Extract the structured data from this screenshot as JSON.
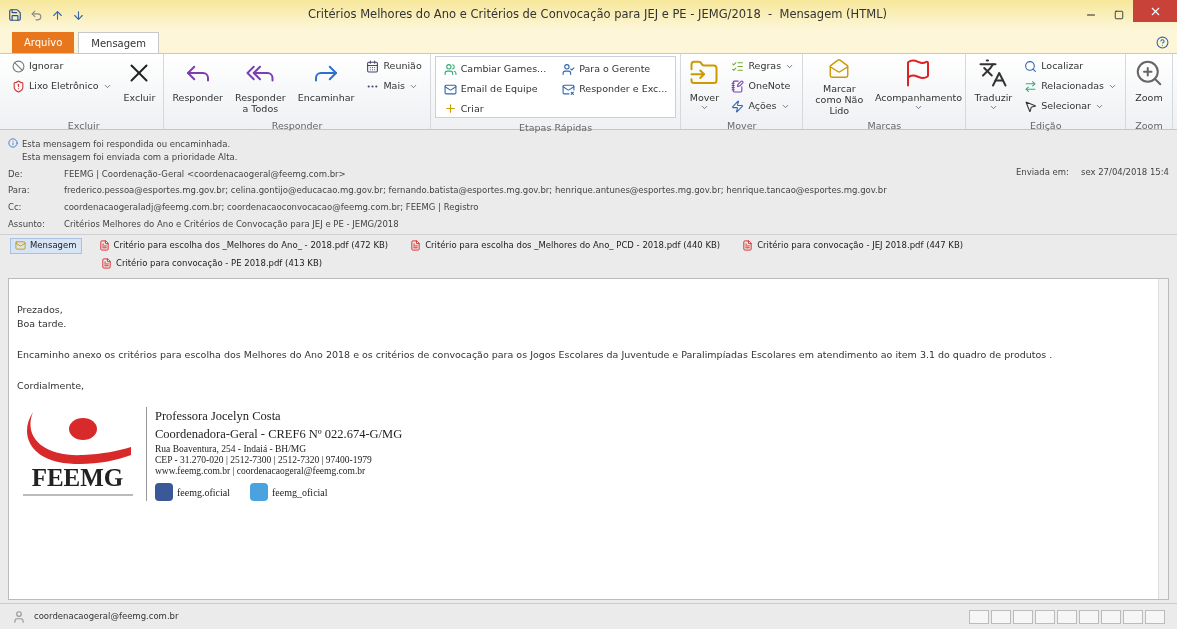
{
  "window": {
    "title": "Critérios Melhores do Ano e Critérios de Convocação para JEJ e PE - JEMG/2018  -  Mensagem (HTML)"
  },
  "tabs": [
    {
      "label": "Arquivo",
      "selected": false,
      "kind": "file"
    },
    {
      "label": "Mensagem",
      "selected": true,
      "kind": "tab"
    }
  ],
  "ribbon": [
    {
      "label": "Excluir",
      "kind": "buttons",
      "items": [
        {
          "kind": "small",
          "label": "Ignorar",
          "menu": false
        },
        {
          "kind": "small",
          "label": "Lixo Eletrônico",
          "menu": true
        },
        {
          "kind": "large",
          "label": "Excluir",
          "menu": false
        }
      ]
    },
    {
      "label": "Responder",
      "kind": "buttons",
      "items": [
        {
          "kind": "large",
          "label": "Responder",
          "menu": false
        },
        {
          "kind": "large",
          "label": "Responder a Todos",
          "menu": false
        },
        {
          "kind": "large",
          "label": "Encaminhar",
          "menu": false
        },
        {
          "kind": "small",
          "label": "Reunião",
          "menu": false
        },
        {
          "kind": "small",
          "label": "Mais",
          "menu": true
        }
      ]
    },
    {
      "label": "Etapas Rápidas",
      "kind": "gallery",
      "items": [
        {
          "kind": "small",
          "label": "Cambiar Games...",
          "menu": false
        },
        {
          "kind": "small",
          "label": "Email de Equipe",
          "menu": false
        },
        {
          "kind": "small",
          "label": "Criar",
          "menu": false
        },
        {
          "kind": "small",
          "label": "Para o Gerente",
          "menu": false
        },
        {
          "kind": "small",
          "label": "Responder e Exc...",
          "menu": false
        }
      ]
    },
    {
      "label": "Mover",
      "kind": "buttons",
      "items": [
        {
          "kind": "large",
          "label": "Mover",
          "menu": true
        },
        {
          "kind": "small",
          "label": "Regras",
          "menu": true
        },
        {
          "kind": "small",
          "label": "OneNote",
          "menu": false
        },
        {
          "kind": "small",
          "label": "Ações",
          "menu": true
        }
      ]
    },
    {
      "label": "Marcas",
      "kind": "buttons",
      "items": [
        {
          "kind": "large",
          "label": "Marcar como Não Lido",
          "menu": false
        },
        {
          "kind": "large",
          "label": "Acompanhamento",
          "menu": true
        }
      ]
    },
    {
      "label": "Edição",
      "kind": "buttons",
      "items": [
        {
          "kind": "large",
          "label": "Traduzir",
          "menu": true
        },
        {
          "kind": "small",
          "label": "Localizar",
          "menu": false
        },
        {
          "kind": "small",
          "label": "Relacionadas",
          "menu": true
        },
        {
          "kind": "small",
          "label": "Selecionar",
          "menu": true
        }
      ]
    },
    {
      "label": "Zoom",
      "kind": "buttons",
      "items": [
        {
          "kind": "large",
          "label": "Zoom",
          "menu": false
        }
      ]
    }
  ],
  "header": {
    "notices": [
      "Esta mensagem foi respondida ou encaminhada.",
      "Esta mensagem foi enviada com a prioridade Alta."
    ],
    "fields": [
      {
        "label": "De:",
        "value": "FEEMG | Coordenação-Geral <coordenacaogeral@feemg.com.br>"
      },
      {
        "label": "Para:",
        "value": "frederico.pessoa@esportes.mg.gov.br; celina.gontijo@educacao.mg.gov.br; fernando.batista@esportes.mg.gov.br; henrique.antunes@esportes.mg.gov.br; henrique.tancao@esportes.mg.gov.br"
      },
      {
        "label": "Cc:",
        "value": "coordenacaogeraladj@feemg.com.br; coordenacaoconvocacao@feemg.com.br; FEEMG | Registro"
      },
      {
        "label": "Assunto:",
        "value": "Critérios Melhores do Ano e Critérios de Convocação para JEJ e PE - JEMG/2018"
      }
    ],
    "sent": {
      "label": "Enviada em:",
      "value": "sex 27/04/2018 15:4"
    }
  },
  "attachments": [
    {
      "kind": "message",
      "label": "Mensagem",
      "selected": true
    },
    {
      "kind": "pdf",
      "label": "Critério para escolha dos _Melhores do Ano_ - 2018.pdf (472 KB)",
      "selected": false
    },
    {
      "kind": "pdf",
      "label": "Critério para escolha dos _Melhores do Ano_ PCD - 2018.pdf (440 KB)",
      "selected": false
    },
    {
      "kind": "pdf",
      "label": "Critério para convocação - JEJ 2018.pdf (447 KB)",
      "selected": false
    },
    {
      "kind": "pdf",
      "label": "Critério para convocação - PE 2018.pdf (413 KB)",
      "selected": false
    }
  ],
  "body": {
    "paragraphs": [
      [
        "Prezados,",
        "Boa tarde."
      ],
      [
        "Encaminho anexo os critérios para escolha dos Melhores do Ano 2018 e os critérios de convocação para os Jogos Escolares da Juventude e Paralimpíadas Escolares em atendimento ao item 3.1 do quadro de produtos ."
      ],
      [
        "Cordialmente,"
      ]
    ],
    "signature": {
      "logo_text": "FEEMG",
      "name": "Professora Jocelyn Costa",
      "role": "Coordenadora-Geral - CREF6 Nº 022.674-G/MG",
      "lines": [
        "Rua Boaventura, 254 - Indaiá - BH/MG",
        "CEP - 31.270-020 | 2512-7300 | 2512-7320 | 97400-1979",
        "www.feemg.com.br | coordenacaogeral@feemg.com.br"
      ],
      "social": [
        {
          "kind": "facebook",
          "label": "feemg.oficial"
        },
        {
          "kind": "twitter",
          "label": "feemg_oficial"
        }
      ]
    }
  },
  "status_bar": {
    "sender": "coordenacaogeral@feemg.com.br"
  }
}
